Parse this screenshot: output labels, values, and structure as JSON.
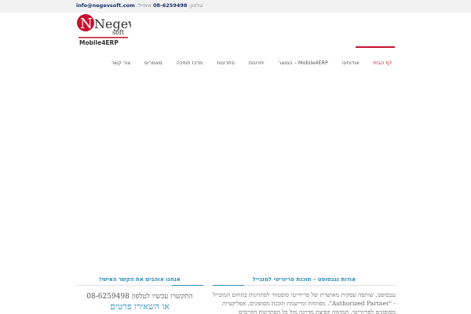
{
  "topbar": {
    "phone_label": "טלפון:",
    "phone": "08-6259498",
    "email_label": "אימייל:",
    "email": "info@negevsoft.com"
  },
  "logo": {
    "brand": "Negev",
    "sub": "soft",
    "tagline": "Mobile4ERP",
    "colors": {
      "red": "#c8102e",
      "dark": "#333333"
    }
  },
  "nav": {
    "items": [
      {
        "label": "דף הבית",
        "active": true
      },
      {
        "label": "אודותינו"
      },
      {
        "label": "המוצר – Mobile4ERP"
      },
      {
        "label": "יתרונות"
      },
      {
        "label": "פתרונות"
      },
      {
        "label": "מרכז תמיכה"
      },
      {
        "label": "מאמרים"
      },
      {
        "label": "צור קשר"
      }
    ]
  },
  "contact_box": {
    "title": "אנחנו אוהבים את הקשר האישי!",
    "phone_line": "התקשרו עכשיו לטלפון 08-6259498",
    "cta": "או השאירו פרטים"
  },
  "about_box": {
    "title": "אודות נגבסופט – תוכנת פריוריטי למובייל",
    "text": "נגבסופט, שותפה עסקית מאושרת של פריוריטי סופטוור לפתרונות בתחום המובייל - \"Authorized Partner\", מפתחת ומיישמת תוכנת מסופונים, אפליקציות מסופונים לפריוריטי, המהווה קפיצת מדרגה מול כל הפתרונות הקיימים"
  },
  "colors": {
    "accent": "#2e8ab8",
    "brand_red": "#c8102e",
    "topbar_bg": "#f2f2f2"
  }
}
